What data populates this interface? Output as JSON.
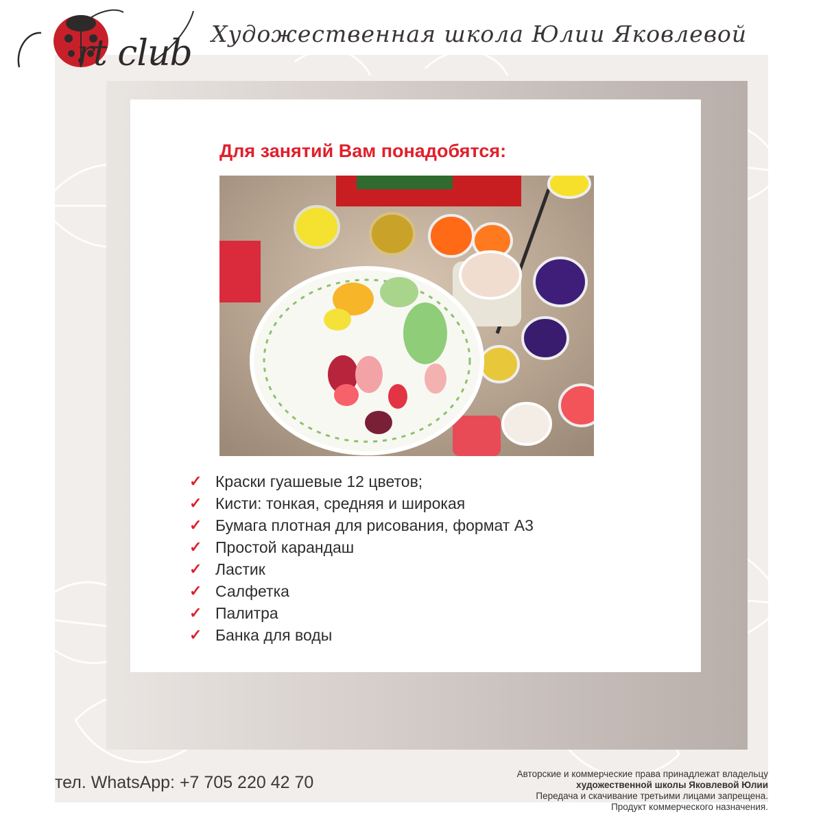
{
  "header": {
    "logo_text": "rt club",
    "logo_letter": "A",
    "school_name": "Художественная школа Юлии Яковлевой"
  },
  "content": {
    "heading": "Для занятий Вам понадобятся:",
    "photo_alt": "Гуашевые краски и палитра",
    "materials": [
      "Краски гуашевые 12 цветов;",
      "Кисти: тонкая, средняя и широкая",
      "Бумага плотная для рисования, формат А3",
      "Простой карандаш",
      "Ластик",
      "Салфетка",
      "Палитра",
      "Банка для воды"
    ],
    "check_glyph": "✓"
  },
  "footer": {
    "phone": "тел. WhatsApp: +7 705 220 42 70",
    "copyright_line1": "Авторские и коммерческие права принадлежат владельцу",
    "copyright_line2": "художественной школы Яковлевой Юлии",
    "copyright_line3": "Передача и скачивание третьими лицами запрещена.",
    "copyright_line4": "Продукт коммерческого назначения."
  },
  "colors": {
    "accent_red": "#e0202c",
    "frame_gray": "#b8aeaa",
    "text_dark": "#2d2d2d"
  }
}
